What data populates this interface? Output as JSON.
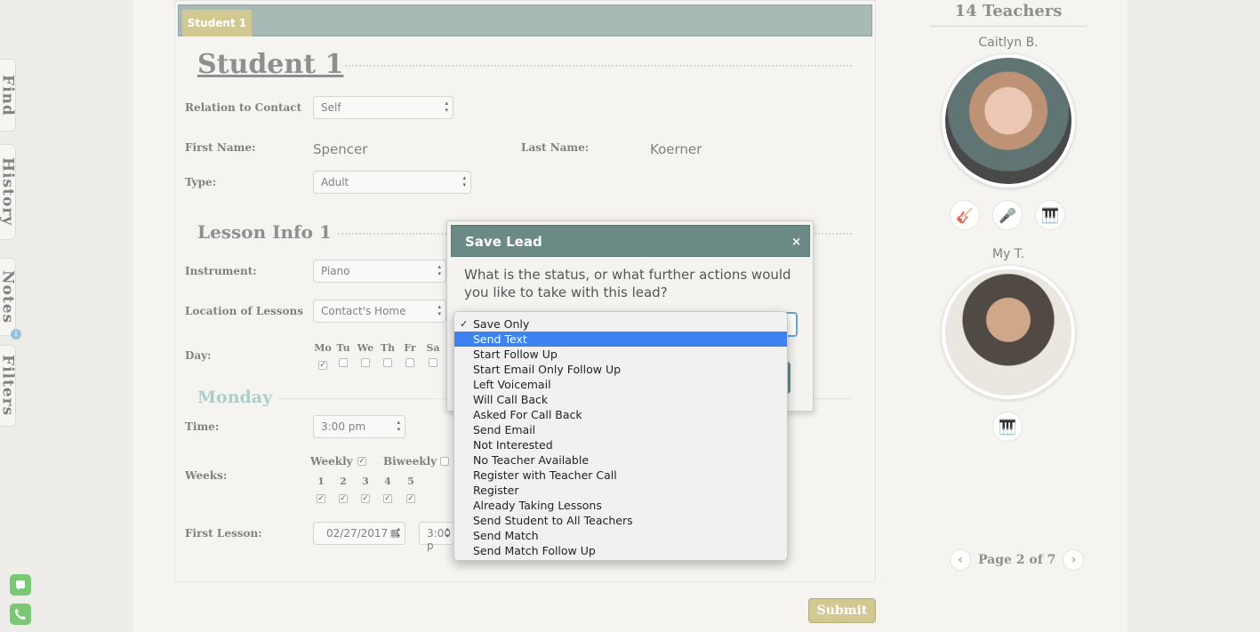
{
  "sidebar": {
    "tabs": [
      "Find",
      "History",
      "Notes",
      "Filters"
    ],
    "notes_badge": "i"
  },
  "student": {
    "tab_label": "Student 1",
    "section_title": "Student 1",
    "relation_label": "Relation to Contact",
    "relation_value": "Self",
    "first_name_label": "First Name:",
    "first_name_value": "Spencer",
    "last_name_label": "Last Name:",
    "last_name_value": "Koerner",
    "type_label": "Type:",
    "type_value": "Adult"
  },
  "lesson": {
    "section_title": "Lesson Info 1",
    "instrument_label": "Instrument:",
    "instrument_value": "Piano",
    "location_label": "Location of Lessons",
    "location_value": "Contact's Home",
    "day_label": "Day:",
    "days": [
      {
        "label": "Mo",
        "checked": true
      },
      {
        "label": "Tu",
        "checked": false
      },
      {
        "label": "We",
        "checked": false
      },
      {
        "label": "Th",
        "checked": false
      },
      {
        "label": "Fr",
        "checked": false
      },
      {
        "label": "Sa",
        "checked": false
      }
    ],
    "day_title": "Monday",
    "time_label": "Time:",
    "time_value": "3:00 pm",
    "weeks_label": "Weeks:",
    "weekly_label": "Weekly",
    "biweekly_label": "Biweekly",
    "week_numbers": [
      "1",
      "2",
      "3",
      "4",
      "5"
    ],
    "first_lesson_label": "First Lesson:",
    "first_lesson_date": "02/27/2017",
    "first_lesson_time": "3:00 p"
  },
  "submit_label": "Submit",
  "teachers": {
    "title": "14 Teachers",
    "list": [
      {
        "name": "Caitlyn B.",
        "instruments": [
          "guitar-icon",
          "microphone-icon",
          "piano-icon"
        ]
      },
      {
        "name": "My T.",
        "instruments": [
          "piano-icon"
        ]
      }
    ],
    "page_label": "Page 2 of 7"
  },
  "modal": {
    "title": "Save Lead",
    "close": "×",
    "question": "What is the status, or what further actions would you like to take with this lead?",
    "options": [
      "Save Only",
      "Send Text",
      "Start Follow Up",
      "Start Email Only Follow Up",
      "Left Voicemail",
      "Will Call Back",
      "Asked For Call Back",
      "Send Email",
      "Not Interested",
      "No Teacher Available",
      "Register with Teacher Call",
      "Register",
      "Already Taking Lessons",
      "Send Student to All Teachers",
      "Send Match",
      "Send Match Follow Up"
    ],
    "selected_option": "Save Only",
    "highlighted_option": "Send Text"
  },
  "colors": {
    "header_teal": "#6b8985",
    "tab_gold": "#c9bd7a",
    "highlight_blue": "#3d82f0",
    "monday_teal": "#9cc4c0"
  }
}
